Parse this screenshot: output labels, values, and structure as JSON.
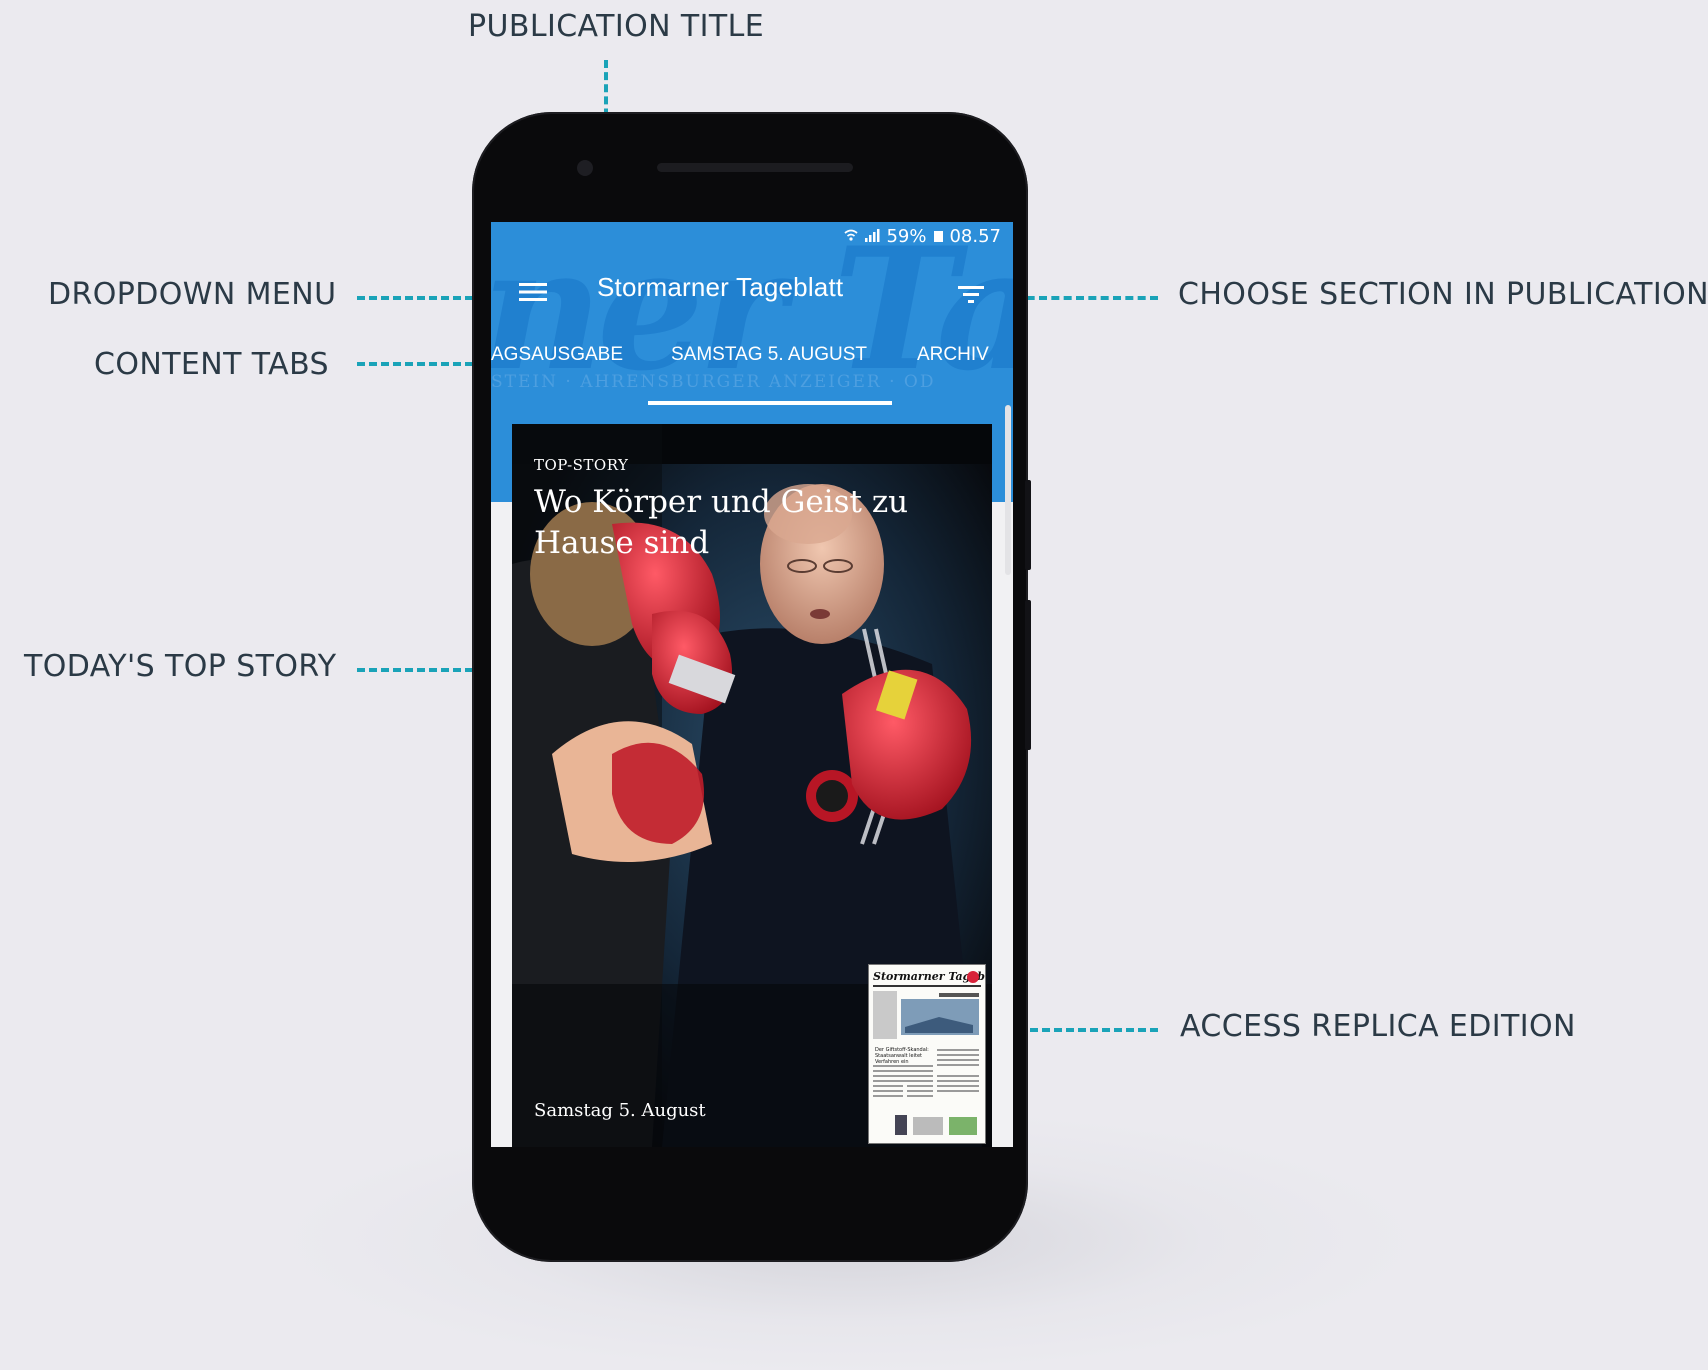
{
  "callouts": {
    "publication_title": "PUBLICATION TITLE",
    "dropdown_menu": "DROPDOWN MENU",
    "content_tabs": "CONTENT TABS",
    "top_story": "TODAY'S TOP STORY",
    "choose_section": "CHOOSE SECTION IN PUBLICATION",
    "replica_edition": "ACCESS REPLICA EDITION"
  },
  "colors": {
    "accent": "#1aa3b8",
    "app_bar": "#2c8ed9",
    "callout_text": "#2b3a46",
    "background": "#ebeaef"
  },
  "status_bar": {
    "battery": "59%",
    "time": "08.57",
    "icons": [
      "wifi-icon",
      "signal-icon",
      "battery-icon"
    ]
  },
  "app_bar": {
    "title": "Stormarner Tageblatt",
    "watermark_text": "ner Tag",
    "watermark_band": "STEIN  ·  AHRENSBURGER ANZEIGER  ·  OD",
    "menu_icon": "hamburger-menu-icon",
    "section_icon": "filter-sections-icon"
  },
  "tabs": [
    {
      "label": "AGSAUSGABE",
      "selected": false
    },
    {
      "label": "SAMSTAG 5. AUGUST",
      "selected": true
    },
    {
      "label": "ARCHIV",
      "selected": false
    }
  ],
  "top_story": {
    "kicker": "TOP-STORY",
    "headline": "Wo Körper und Geist zu Hause sind",
    "date": "Samstag 5. August"
  },
  "replica": {
    "masthead": "Stormarner Tageblatt",
    "headline": "Der Giftstoff-Skandal: Staatsanwalt leitet Verfahren ein"
  }
}
